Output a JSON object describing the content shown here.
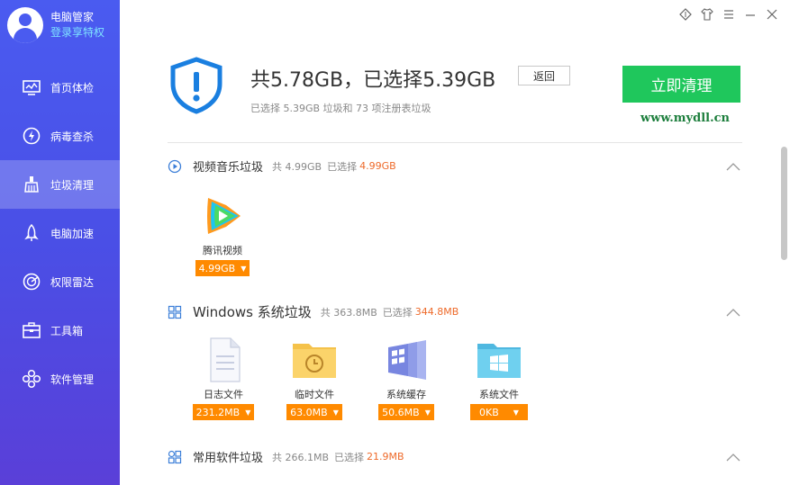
{
  "sidebar": {
    "user": {
      "name": "电脑管家",
      "link": "登录享特权"
    },
    "items": [
      {
        "label": "首页体检",
        "icon": "monitor-icon"
      },
      {
        "label": "病毒查杀",
        "icon": "lightning-icon"
      },
      {
        "label": "垃圾清理",
        "icon": "broom-icon",
        "active": true
      },
      {
        "label": "电脑加速",
        "icon": "rocket-icon"
      },
      {
        "label": "权限雷达",
        "icon": "radar-icon"
      },
      {
        "label": "工具箱",
        "icon": "toolbox-icon"
      },
      {
        "label": "软件管理",
        "icon": "software-icon"
      }
    ]
  },
  "window": {
    "controls": [
      "skin-icon",
      "shirt-icon",
      "menu-icon",
      "minimize-icon",
      "close-icon"
    ]
  },
  "header": {
    "summary": "共5.78GB，已选择5.39GB",
    "back_label": "返回",
    "sub_summary": "已选择 5.39GB 垃圾和 73 项注册表垃圾",
    "clean_label": "立即清理",
    "site": "www.mydll.cn"
  },
  "sections": [
    {
      "title": "视频音乐垃圾",
      "total": "共 4.99GB",
      "selected_prefix": "已选择",
      "selected": "4.99GB",
      "items": [
        {
          "label": "腾讯视频",
          "size": "4.99GB"
        }
      ]
    },
    {
      "title": "Windows 系统垃圾",
      "total": "共 363.8MB",
      "selected_prefix": "已选择",
      "selected": "344.8MB",
      "items": [
        {
          "label": "日志文件",
          "size": "231.2MB"
        },
        {
          "label": "临时文件",
          "size": "63.0MB"
        },
        {
          "label": "系统缓存",
          "size": "50.6MB"
        },
        {
          "label": "系统文件",
          "size": "0KB"
        }
      ]
    },
    {
      "title": "常用软件垃圾",
      "total": "共 266.1MB",
      "selected_prefix": "已选择",
      "selected": "21.9MB",
      "items": []
    }
  ],
  "colors": {
    "accent": "#1fc75c",
    "sidebar": "#4a5bf0",
    "size_button": "#ff8a00",
    "selected_text": "#ee6a2a"
  }
}
